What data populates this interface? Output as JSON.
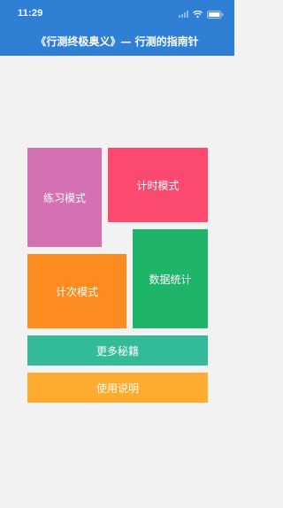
{
  "status_bar": {
    "time": "11:29",
    "icons": [
      "cellular-signal-icon",
      "wifi-icon",
      "battery-icon"
    ]
  },
  "nav": {
    "title": "《行测终极奥义》— 行测的指南针"
  },
  "menu": {
    "practice_mode": "练习模式",
    "timer_mode": "计时模式",
    "count_mode": "计次模式",
    "statistics": "数据统计",
    "more_tips": "更多秘籍",
    "instructions": "使用说明"
  },
  "colors": {
    "header": "#2f7fd5",
    "background": "#f2f2f2",
    "practice_mode": "#d471b3",
    "timer_mode": "#fc4970",
    "count_mode": "#fd8c20",
    "statistics": "#1eb46a",
    "more_tips": "#33bb99",
    "instructions": "#fdac2f"
  }
}
